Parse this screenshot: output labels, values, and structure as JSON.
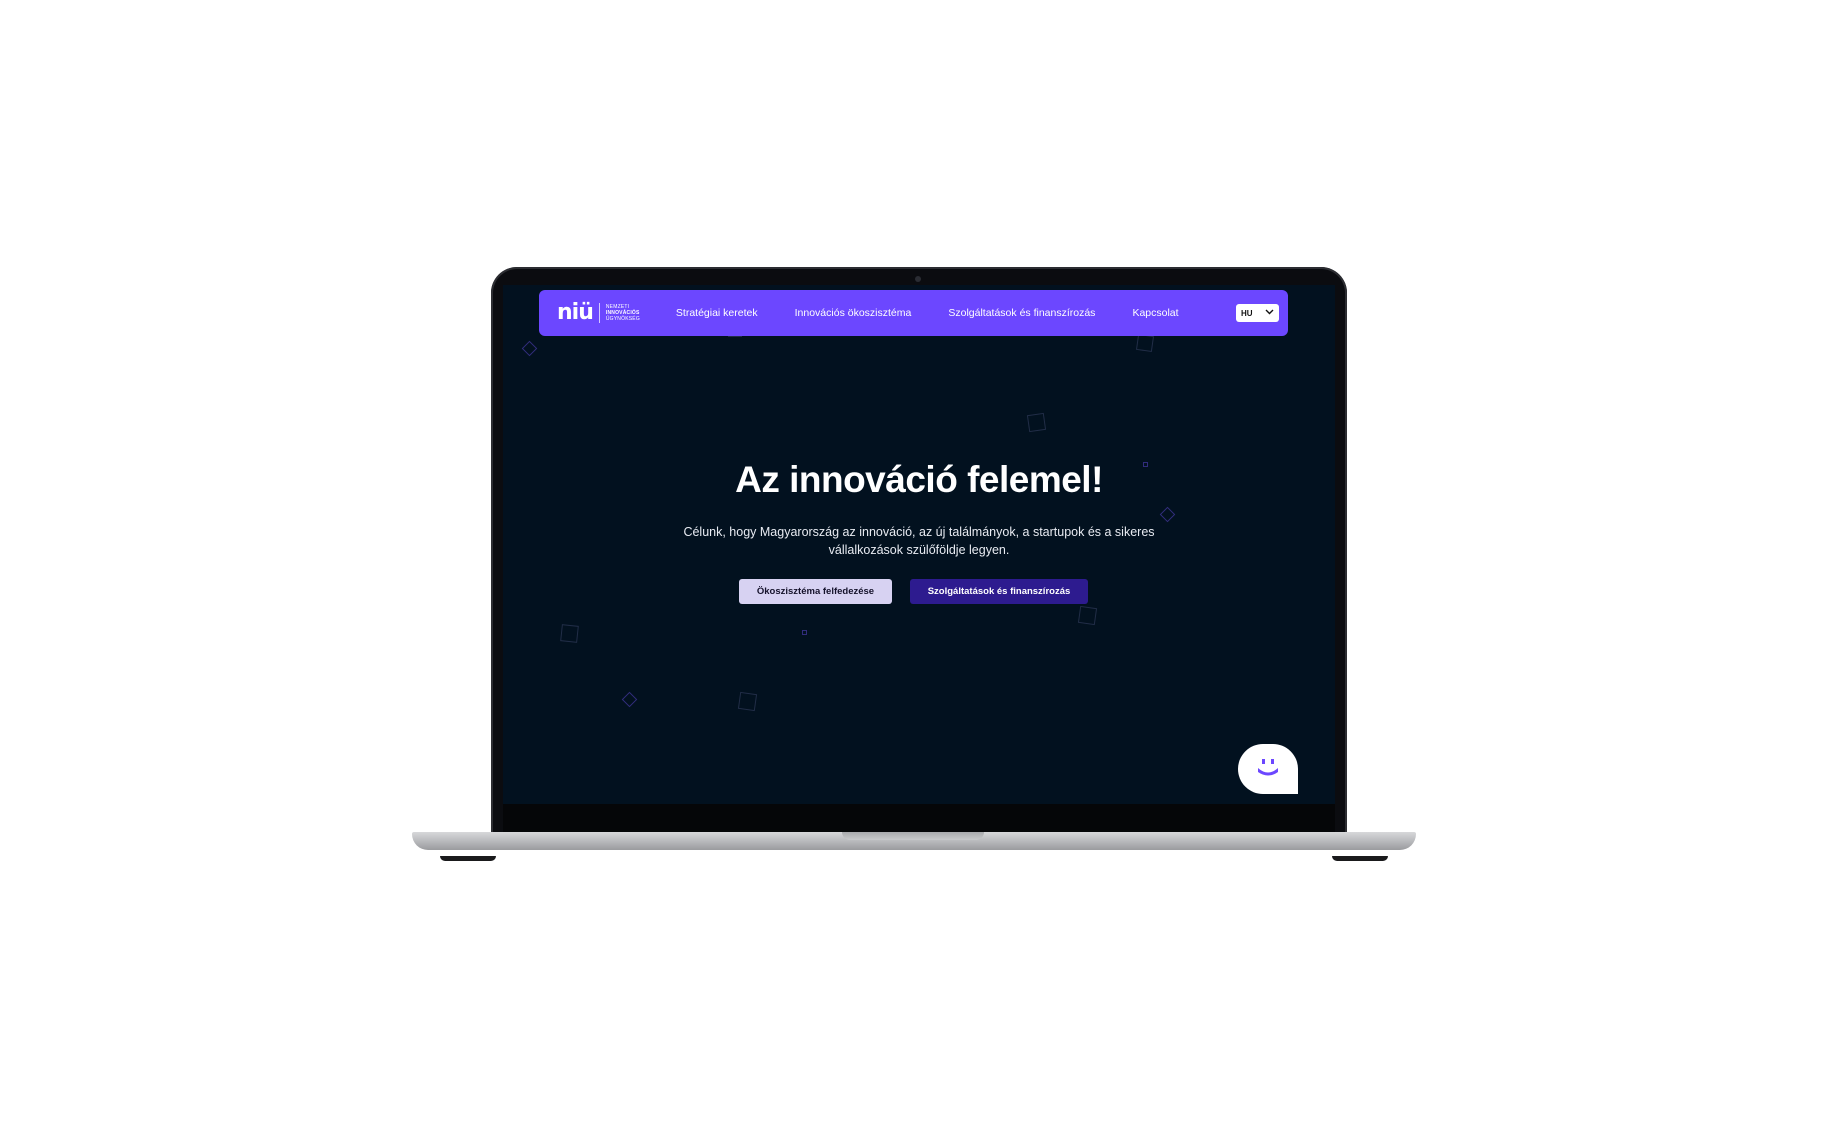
{
  "nav": {
    "logo_mark": "niü",
    "logo_lines": [
      "NEMZETI",
      "INNOVÁCIÓS",
      "ÜGYNÖKSÉG"
    ],
    "links": [
      "Stratégiai keretek",
      "Innovációs ökoszisztéma",
      "Szolgáltatások és finanszírozás",
      "Kapcsolat"
    ],
    "language": "HU"
  },
  "hero": {
    "title": "Az innováció felemel!",
    "subtitle_line1": "Célunk, hogy Magyarország az innováció, az új találmányok, a startupok és a sikeres",
    "subtitle_line2": "vállalkozások szülőföldje legyen.",
    "primary_button": "Ökoszisztéma felfedezése",
    "secondary_button": "Szolgáltatások és finanszírozás"
  },
  "colors": {
    "nav_bg": "#6c47ff",
    "screen_bg": "#02111f",
    "primary_button_bg": "#d7d2f2",
    "secondary_button_bg": "#2d1b8f"
  },
  "icons": {
    "chevron": "chevron-down-icon",
    "chat": "chat-bot-icon"
  }
}
